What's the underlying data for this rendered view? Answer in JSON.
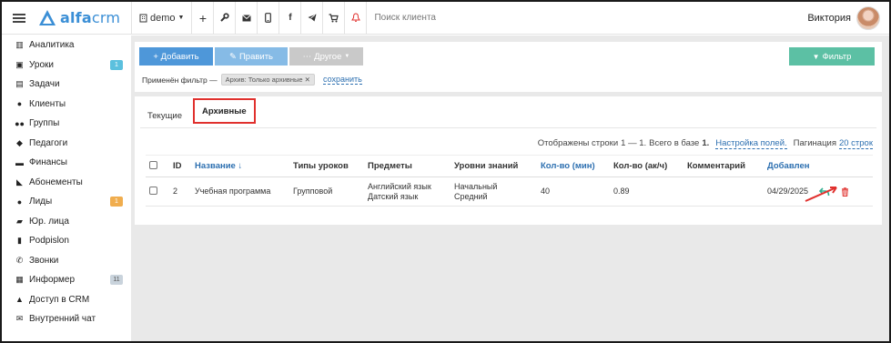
{
  "topbar": {
    "logo_bold": "alfa",
    "logo_light": "crm",
    "company": "demo",
    "icons": [
      "plus-icon",
      "wrench-icon",
      "mail-icon",
      "phone-icon",
      "facebook-icon",
      "telegram-icon",
      "cart-icon",
      "bell-icon"
    ],
    "search_placeholder": "Поиск клиента",
    "user_name": "Виктория"
  },
  "sidebar": {
    "items": [
      {
        "label": "Аналитика",
        "icon": "map-icon"
      },
      {
        "label": "Уроки",
        "icon": "calendar-icon",
        "badge": "1",
        "badge_color": "#5bc0de"
      },
      {
        "label": "Задачи",
        "icon": "clipboard-icon"
      },
      {
        "label": "Клиенты",
        "icon": "user-icon"
      },
      {
        "label": "Группы",
        "icon": "users-icon"
      },
      {
        "label": "Педагоги",
        "icon": "graduation-cap-icon"
      },
      {
        "label": "Финансы",
        "icon": "money-icon"
      },
      {
        "label": "Абонементы",
        "icon": "tag-icon"
      },
      {
        "label": "Лиды",
        "icon": "user-plus-icon",
        "badge": "1",
        "badge_color": "#f0ad4e"
      },
      {
        "label": "Юр. лица",
        "icon": "briefcase-icon"
      },
      {
        "label": "Podpislon",
        "icon": "file-icon"
      },
      {
        "label": "Звонки",
        "icon": "phone-icon"
      },
      {
        "label": "Информер",
        "icon": "newspaper-icon",
        "badge": "11",
        "badge_color": "#c9d3dc"
      },
      {
        "label": "Доступ в CRM",
        "icon": "lock-icon"
      },
      {
        "label": "Внутренний чат",
        "icon": "envelope-icon"
      }
    ]
  },
  "toolbar": {
    "add_label": "+ Добавить",
    "edit_label": "Править",
    "other_label": "Другое",
    "filter_label": "Фильтр",
    "applied_filter_label": "Применён фильтр —",
    "filter_chip": "Архив: Только архивные",
    "save_link": "сохранить"
  },
  "tabs": [
    {
      "label": "Текущие",
      "active": false
    },
    {
      "label": "Архивные",
      "active": true
    }
  ],
  "table_info": {
    "shown_text": "Отображены строки",
    "range": "1 — 1.",
    "total_text": "Всего в базе",
    "total": "1.",
    "settings_link": "Настройка полей.",
    "pagination_text": "Пагинация",
    "pagination_link": "20 строк"
  },
  "table": {
    "headers": [
      "ID",
      "Название ↓",
      "Типы уроков",
      "Предметы",
      "Уровни знаний",
      "Кол-во (мин)",
      "Кол-во (ак/ч)",
      "Комментарий",
      "Добавлен"
    ],
    "rows": [
      {
        "id": "2",
        "name": "Учебная программа",
        "lesson_type": "Групповой",
        "subjects": [
          "Английский язык",
          "Датский язык"
        ],
        "levels": [
          "Начальный",
          "Средний"
        ],
        "minutes": "40",
        "hours": "0.89",
        "comment": "",
        "added": "04/29/2025"
      }
    ]
  },
  "colors": {
    "accent_blue": "#4e97d9",
    "filter_green": "#5cc0a4",
    "restore_green": "#2fae8f",
    "delete_red": "#e0302d",
    "annotation_red": "#e0302d"
  }
}
